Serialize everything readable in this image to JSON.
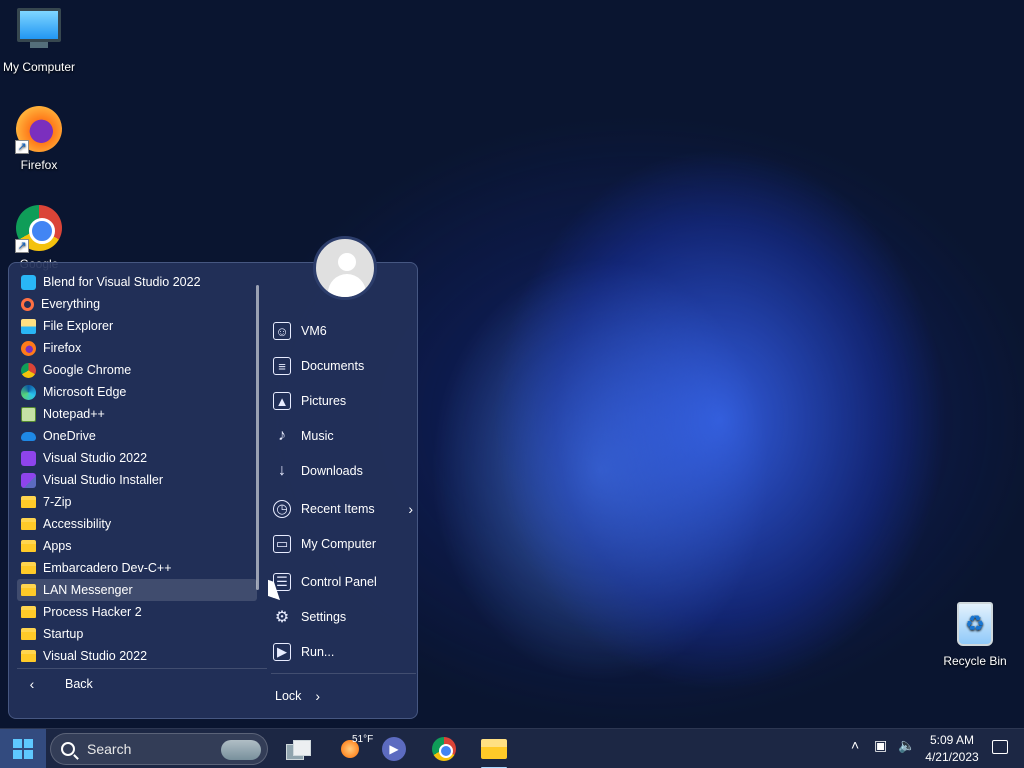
{
  "desktop": {
    "icons": [
      {
        "label": "My Computer",
        "icon": "monitor-icon"
      },
      {
        "label": "Firefox",
        "icon": "firefox-icon"
      },
      {
        "label": "Google",
        "icon": "chrome-icon"
      },
      {
        "label": "Recycle Bin",
        "icon": "recycle-bin-icon"
      }
    ]
  },
  "start_menu": {
    "apps": [
      {
        "label": "Blend for Visual Studio 2022",
        "icon": "blend-icon"
      },
      {
        "label": "Everything",
        "icon": "everything-icon"
      },
      {
        "label": "File Explorer",
        "icon": "file-explorer-icon"
      },
      {
        "label": "Firefox",
        "icon": "firefox-icon"
      },
      {
        "label": "Google Chrome",
        "icon": "chrome-icon"
      },
      {
        "label": "Microsoft Edge",
        "icon": "edge-icon"
      },
      {
        "label": "Notepad++",
        "icon": "notepad-plus-plus-icon"
      },
      {
        "label": "OneDrive",
        "icon": "onedrive-icon"
      },
      {
        "label": "Visual Studio 2022",
        "icon": "visual-studio-icon"
      },
      {
        "label": "Visual Studio Installer",
        "icon": "visual-studio-installer-icon"
      },
      {
        "label": "7-Zip",
        "icon": "folder-icon"
      },
      {
        "label": "Accessibility",
        "icon": "folder-icon"
      },
      {
        "label": "Apps",
        "icon": "folder-icon"
      },
      {
        "label": "Embarcadero Dev-C++",
        "icon": "folder-icon"
      },
      {
        "label": "LAN Messenger",
        "icon": "folder-icon"
      },
      {
        "label": "Process Hacker 2",
        "icon": "folder-icon"
      },
      {
        "label": "Startup",
        "icon": "folder-icon"
      },
      {
        "label": "Visual Studio 2022",
        "icon": "folder-icon"
      }
    ],
    "selected_app": "LAN Messenger",
    "back_label": "Back",
    "places": [
      {
        "label": "VM6",
        "icon": "user-folder-icon"
      },
      {
        "label": "Documents",
        "icon": "document-icon"
      },
      {
        "label": "Pictures",
        "icon": "picture-icon"
      },
      {
        "label": "Music",
        "icon": "music-icon"
      },
      {
        "label": "Downloads",
        "icon": "download-icon"
      },
      {
        "label": "Recent Items",
        "icon": "clock-icon"
      },
      {
        "label": "My Computer",
        "icon": "computer-icon"
      },
      {
        "label": "Control Panel",
        "icon": "control-panel-icon"
      },
      {
        "label": "Settings",
        "icon": "gear-icon"
      },
      {
        "label": "Run...",
        "icon": "run-icon"
      }
    ],
    "lock_label": "Lock"
  },
  "taskbar": {
    "search_placeholder": "Search",
    "weather_temp": "51°F",
    "time": "5:09 AM",
    "date": "4/21/2023"
  }
}
